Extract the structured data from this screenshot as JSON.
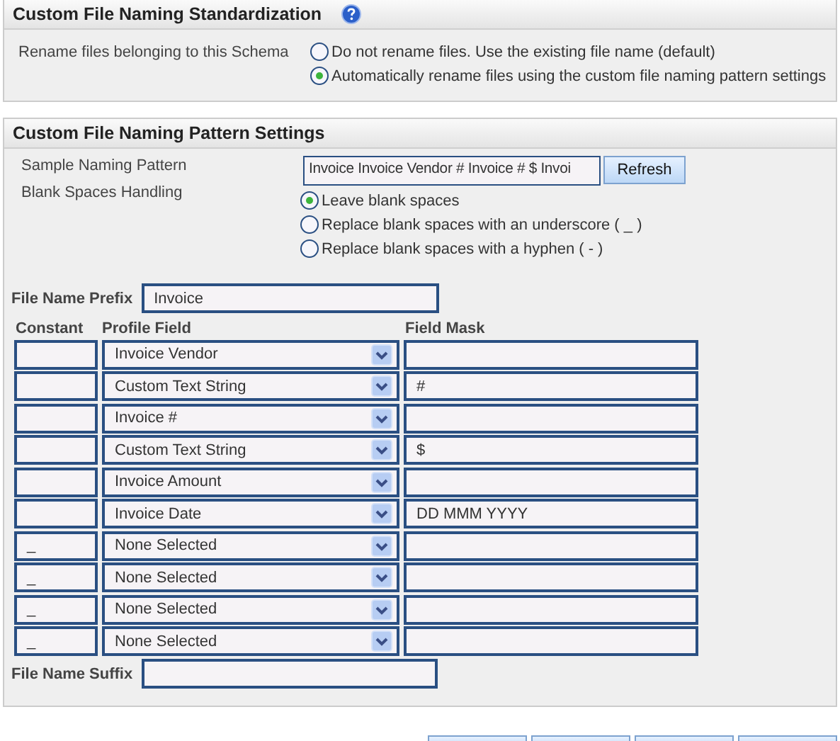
{
  "standardization": {
    "title": "Custom File Naming Standardization",
    "label": "Rename files belonging to this Schema",
    "options": [
      {
        "label": "Do not rename files. Use the existing file name (default)",
        "selected": false
      },
      {
        "label": "Automatically rename files using the custom file naming pattern settings",
        "selected": true
      }
    ]
  },
  "pattern": {
    "title": "Custom File Naming Pattern Settings",
    "sample_label": "Sample Naming Pattern",
    "sample_value": "Invoice Invoice Vendor # Invoice # $ Invoi",
    "refresh": "Refresh",
    "blank_label": "Blank Spaces Handling",
    "blank_options": [
      {
        "label": "Leave blank spaces",
        "selected": true
      },
      {
        "label": "Replace blank spaces with an underscore ( _ )",
        "selected": false
      },
      {
        "label": "Replace blank spaces with a hyphen ( - )",
        "selected": false
      }
    ],
    "prefix_label": "File Name Prefix",
    "prefix_value": "Invoice",
    "columns": [
      "Constant",
      "Profile Field",
      "Field Mask"
    ],
    "rows": [
      {
        "profile_field": "Invoice Vendor"
      },
      {
        "profile_field": "Custom Text String",
        "field_mask": "#"
      },
      {
        "profile_field": "Invoice #"
      },
      {
        "profile_field": "Custom Text String",
        "field_mask": "$"
      },
      {
        "profile_field": "Invoice Amount"
      },
      {
        "profile_field": "Invoice Date",
        "field_mask": "DD MMM YYYY"
      },
      {
        "constant": "_",
        "profile_field": "None Selected"
      },
      {
        "constant": "_",
        "profile_field": "None Selected"
      },
      {
        "constant": "_",
        "profile_field": "None Selected"
      },
      {
        "constant": "_",
        "profile_field": "None Selected"
      }
    ],
    "suffix_label": "File Name Suffix"
  }
}
